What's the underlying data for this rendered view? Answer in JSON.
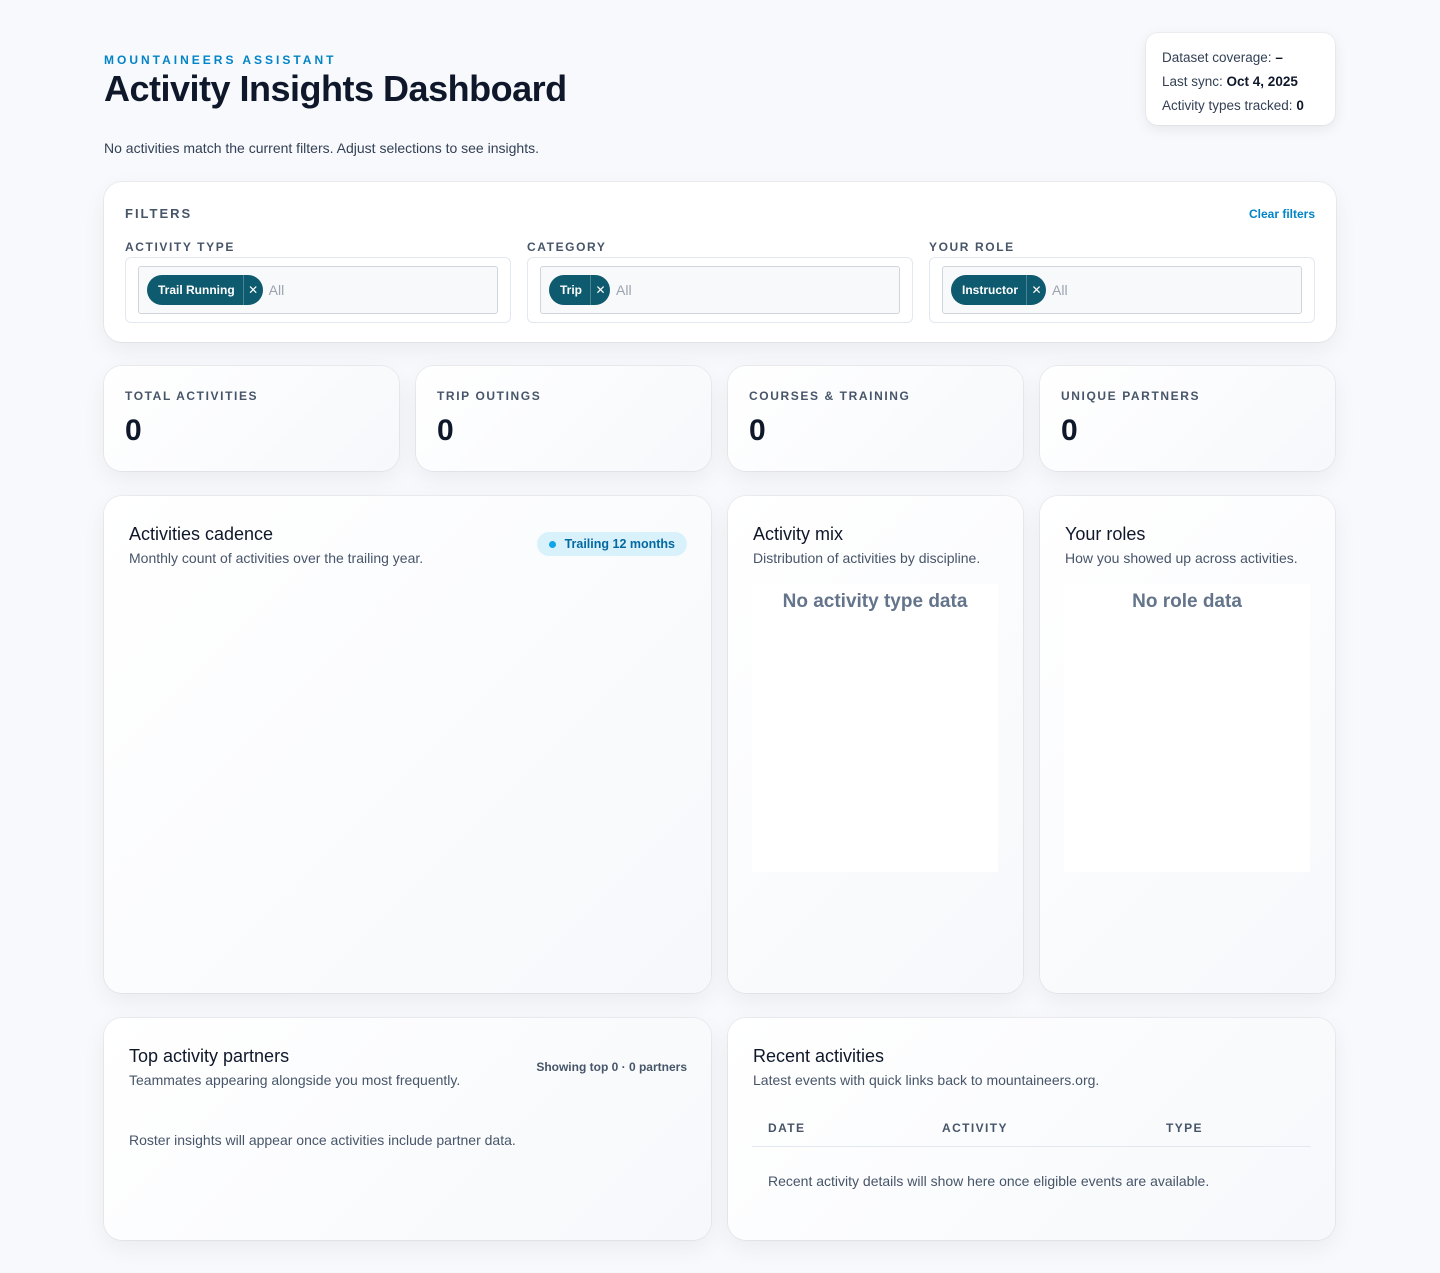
{
  "header": {
    "eyebrow": "MOUNTAINEERS ASSISTANT",
    "title": "Activity Insights Dashboard",
    "subtitle": "No activities match the current filters. Adjust selections to see insights."
  },
  "meta": {
    "coverage_label": "Dataset coverage:",
    "coverage_value": "–",
    "sync_label": "Last sync:",
    "sync_value": "Oct 4, 2025",
    "types_label": "Activity types tracked:",
    "types_value": "0"
  },
  "filters": {
    "title": "FILTERS",
    "clear_label": "Clear filters",
    "groups": [
      {
        "label": "ACTIVITY TYPE",
        "chip": "Trail Running",
        "placeholder": "All"
      },
      {
        "label": "CATEGORY",
        "chip": "Trip",
        "placeholder": "All"
      },
      {
        "label": "YOUR ROLE",
        "chip": "Instructor",
        "placeholder": "All"
      }
    ]
  },
  "stats": [
    {
      "label": "TOTAL ACTIVITIES",
      "value": "0"
    },
    {
      "label": "TRIP OUTINGS",
      "value": "0"
    },
    {
      "label": "COURSES & TRAINING",
      "value": "0"
    },
    {
      "label": "UNIQUE PARTNERS",
      "value": "0"
    }
  ],
  "cadence": {
    "title": "Activities cadence",
    "subtitle": "Monthly count of activities over the trailing year.",
    "pill": "Trailing 12 months"
  },
  "mix": {
    "title": "Activity mix",
    "subtitle": "Distribution of activities by discipline.",
    "empty": "No activity type data"
  },
  "roles": {
    "title": "Your roles",
    "subtitle": "How you showed up across activities.",
    "empty": "No role data"
  },
  "partners": {
    "title": "Top activity partners",
    "subtitle": "Teammates appearing alongside you most frequently.",
    "count": "Showing top 0 · 0 partners",
    "empty": "Roster insights will appear once activities include partner data."
  },
  "recent": {
    "title": "Recent activities",
    "subtitle": "Latest events with quick links back to mountaineers.org.",
    "columns": [
      "DATE",
      "ACTIVITY",
      "TYPE"
    ],
    "empty": "Recent activity details will show here once eligible events are available."
  },
  "colors": {
    "accent": "#0284c7",
    "chip": "#0e5a6e",
    "pill_bg": "#d9f1fb"
  }
}
